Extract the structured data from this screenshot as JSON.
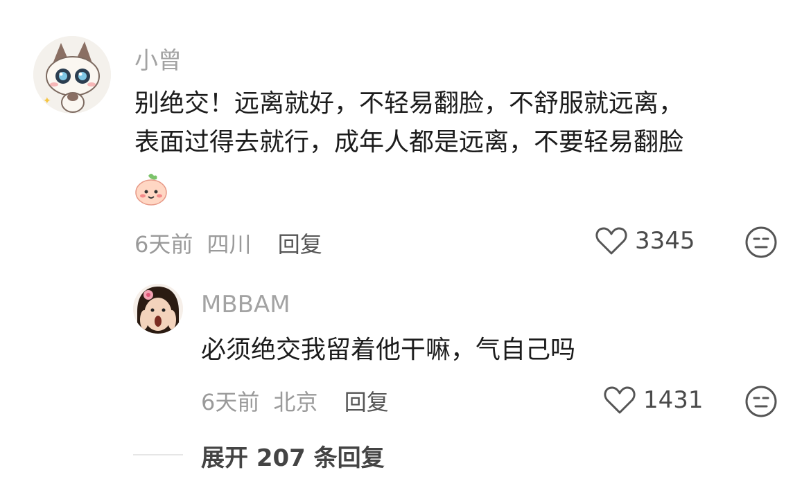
{
  "comments": [
    {
      "username": "小曾",
      "text_line1": "别绝交！远离就好，不轻易翻脸，不舒服就远离，",
      "text_line2": "表面过得去就行，成年人都是远离，不要轻易翻脸",
      "time": "6天前",
      "location": "四川",
      "reply_label": "回复",
      "likes": "3345"
    },
    {
      "username": "MBBAM",
      "text_line1": "必须绝交我留着他干嘛，气自己吗",
      "time": "6天前",
      "location": "北京",
      "reply_label": "回复",
      "likes": "1431"
    }
  ],
  "expand_replies": "展开 207 条回复"
}
